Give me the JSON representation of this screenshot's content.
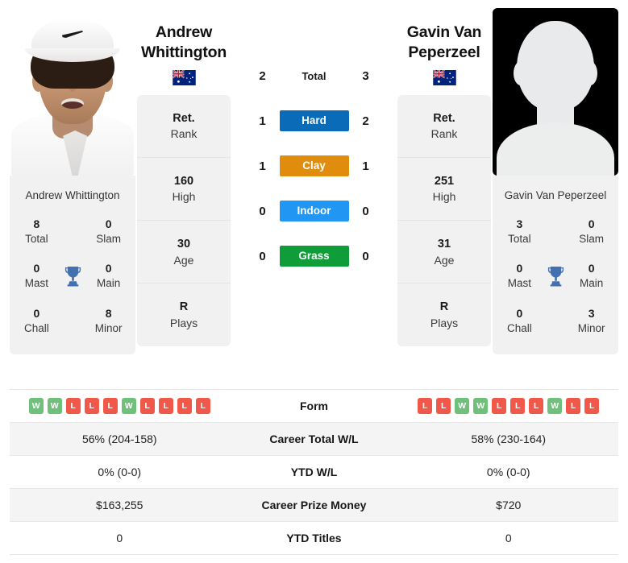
{
  "players": {
    "left": {
      "name_line1": "Andrew",
      "name_line2": "Whittington",
      "full_name": "Andrew Whittington",
      "country": "Australia",
      "flag_icon": "flag-australia-icon",
      "photo_type": "player-photo",
      "rank": {
        "value": "Ret.",
        "label": "Rank"
      },
      "high": {
        "value": "160",
        "label": "High"
      },
      "age": {
        "value": "30",
        "label": "Age"
      },
      "plays": {
        "value": "R",
        "label": "Plays"
      },
      "titles": {
        "total": {
          "value": "8",
          "label": "Total"
        },
        "slam": {
          "value": "0",
          "label": "Slam"
        },
        "mast": {
          "value": "0",
          "label": "Mast"
        },
        "main": {
          "value": "0",
          "label": "Main"
        },
        "chall": {
          "value": "0",
          "label": "Chall"
        },
        "minor": {
          "value": "8",
          "label": "Minor"
        }
      },
      "form": [
        "W",
        "W",
        "L",
        "L",
        "L",
        "W",
        "L",
        "L",
        "L",
        "L"
      ],
      "career_total_wl": "56% (204-158)",
      "ytd_wl": "0% (0-0)",
      "career_prize_money": "$163,255",
      "ytd_titles": "0"
    },
    "right": {
      "name_line1": "Gavin Van",
      "name_line2": "Peperzeel",
      "full_name": "Gavin Van Peperzeel",
      "country": "Australia",
      "flag_icon": "flag-australia-icon",
      "photo_type": "placeholder-silhouette",
      "rank": {
        "value": "Ret.",
        "label": "Rank"
      },
      "high": {
        "value": "251",
        "label": "High"
      },
      "age": {
        "value": "31",
        "label": "Age"
      },
      "plays": {
        "value": "R",
        "label": "Plays"
      },
      "titles": {
        "total": {
          "value": "3",
          "label": "Total"
        },
        "slam": {
          "value": "0",
          "label": "Slam"
        },
        "mast": {
          "value": "0",
          "label": "Mast"
        },
        "main": {
          "value": "0",
          "label": "Main"
        },
        "chall": {
          "value": "0",
          "label": "Chall"
        },
        "minor": {
          "value": "3",
          "label": "Minor"
        }
      },
      "form": [
        "L",
        "L",
        "W",
        "W",
        "L",
        "L",
        "L",
        "W",
        "L",
        "L"
      ],
      "career_total_wl": "58% (230-164)",
      "ytd_wl": "0% (0-0)",
      "career_prize_money": "$720",
      "ytd_titles": "0"
    }
  },
  "head_to_head": {
    "total": {
      "label": "Total",
      "left": "2",
      "right": "3"
    },
    "surfaces": [
      {
        "label": "Hard",
        "left": "1",
        "right": "2",
        "color": "#0a6cb8"
      },
      {
        "label": "Clay",
        "left": "1",
        "right": "1",
        "color": "#e08c0d"
      },
      {
        "label": "Indoor",
        "left": "0",
        "right": "0",
        "color": "#2196f3"
      },
      {
        "label": "Grass",
        "left": "0",
        "right": "0",
        "color": "#0f9d3a"
      }
    ]
  },
  "stats_table": {
    "rows": [
      {
        "label": "Form",
        "left": "",
        "right": ""
      },
      {
        "label": "Career Total W/L",
        "left": "56% (204-158)",
        "right": "58% (230-164)"
      },
      {
        "label": "YTD W/L",
        "left": "0% (0-0)",
        "right": "0% (0-0)"
      },
      {
        "label": "Career Prize Money",
        "left": "$163,255",
        "right": "$720"
      },
      {
        "label": "YTD Titles",
        "left": "0",
        "right": "0"
      }
    ]
  },
  "colors": {
    "hard": "#0a6cb8",
    "clay": "#e08c0d",
    "indoor": "#2196f3",
    "grass": "#0f9d3a",
    "win_badge": "#6fc07a",
    "loss_badge": "#f0594a",
    "trophy": "#4371b0",
    "card_bg": "#f1f1f1"
  }
}
